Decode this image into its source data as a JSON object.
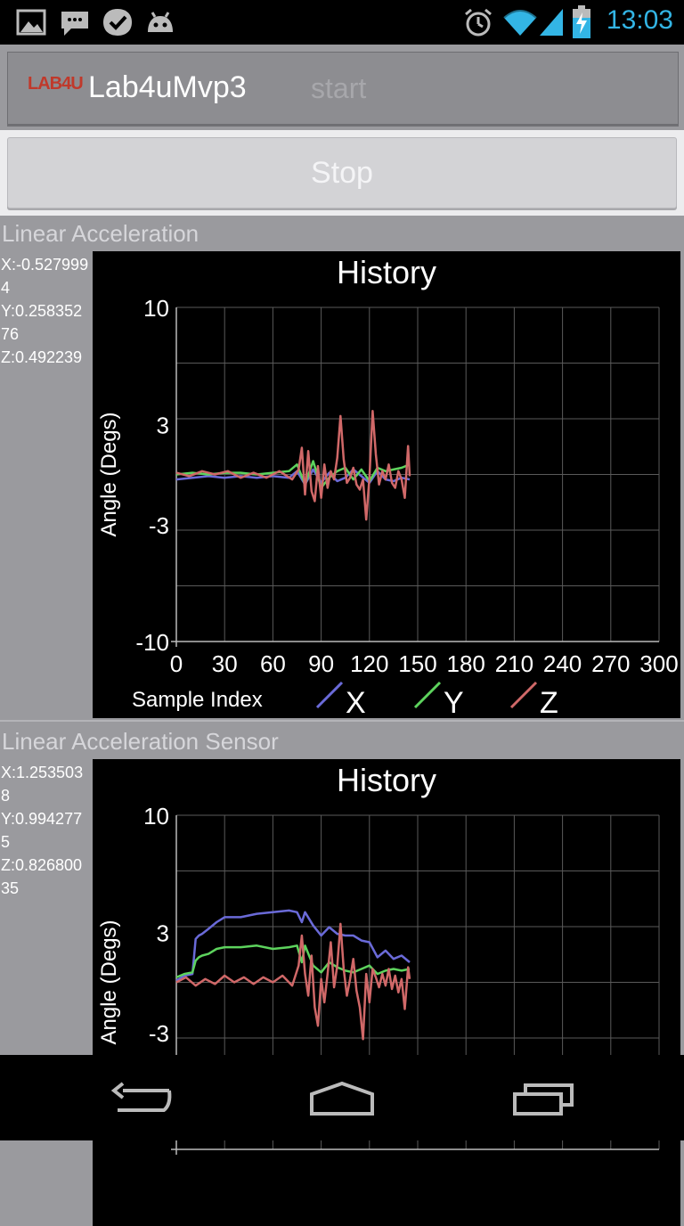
{
  "status_bar": {
    "time": "13:03",
    "icons": [
      "gallery-icon",
      "messenger-icon",
      "checkmark-app-icon",
      "android-debug-icon",
      "alarm-icon",
      "wifi-icon",
      "signal-icon",
      "battery-charging-icon"
    ],
    "accent_color": "#33b5e5"
  },
  "action_bar": {
    "logo_text": "LAB4U",
    "title": "Lab4uMvp3",
    "start_label": "start"
  },
  "stop_button": {
    "label": "Stop"
  },
  "sections": [
    {
      "label": "Linear Acceleration",
      "readout": {
        "x": "X:-0.5279994",
        "y": "Y:0.25835276",
        "z": "Z:0.492239"
      }
    },
    {
      "label": "Linear Acceleration Sensor",
      "readout": {
        "x": "X:1.2535038",
        "y": "Y:0.9942775",
        "z": "Z:0.82680035"
      }
    }
  ],
  "chart_data": [
    {
      "type": "line",
      "title": "History",
      "xlabel": "Sample Index",
      "ylabel": "Angle (Degs)",
      "xlim": [
        0,
        300
      ],
      "ylim": [
        -10,
        10
      ],
      "xticks": [
        "0",
        "30",
        "60",
        "90",
        "120",
        "150",
        "180",
        "210",
        "240",
        "270",
        "300"
      ],
      "yticks": [
        "10",
        "3",
        "-3",
        "-10"
      ],
      "grid": true,
      "legend": "bottom",
      "series": [
        {
          "name": "X",
          "color": "#6a6ad8",
          "x": [
            0,
            10,
            20,
            30,
            40,
            50,
            60,
            70,
            75,
            80,
            85,
            90,
            95,
            100,
            105,
            110,
            115,
            120,
            125,
            130,
            135,
            140,
            145
          ],
          "y": [
            -0.3,
            -0.2,
            -0.1,
            -0.2,
            -0.1,
            -0.2,
            -0.1,
            -0.2,
            0.2,
            -0.6,
            0.3,
            -0.5,
            0.1,
            -0.4,
            -0.2,
            0.3,
            -0.1,
            -0.5,
            0.2,
            -0.3,
            -0.4,
            -0.2,
            -0.3
          ]
        },
        {
          "name": "Y",
          "color": "#5dd35d",
          "x": [
            0,
            10,
            20,
            30,
            40,
            50,
            60,
            70,
            75,
            80,
            85,
            90,
            95,
            100,
            105,
            110,
            115,
            120,
            125,
            130,
            135,
            140,
            145
          ],
          "y": [
            0.0,
            0.1,
            0.0,
            0.1,
            0.1,
            0.0,
            0.1,
            0.2,
            0.6,
            -0.6,
            0.8,
            -0.8,
            -0.2,
            0.2,
            0.4,
            -0.3,
            0.3,
            -0.4,
            0.4,
            0.2,
            0.3,
            0.4,
            0.6
          ]
        },
        {
          "name": "Z",
          "color": "#d06868",
          "x": [
            0,
            8,
            16,
            24,
            32,
            40,
            48,
            56,
            64,
            72,
            76,
            78,
            80,
            82,
            84,
            86,
            88,
            90,
            92,
            94,
            96,
            98,
            100,
            102,
            104,
            106,
            108,
            110,
            112,
            114,
            116,
            118,
            120,
            122,
            124,
            126,
            128,
            130,
            132,
            134,
            136,
            138,
            140,
            142,
            144,
            145
          ],
          "y": [
            0.1,
            -0.1,
            0.2,
            0.0,
            0.2,
            -0.2,
            0.1,
            -0.2,
            0.2,
            -0.3,
            0.3,
            1.6,
            -1.2,
            1.4,
            -1.0,
            -1.6,
            0.5,
            -1.4,
            0.6,
            -0.8,
            0.2,
            -0.3,
            1.0,
            3.5,
            0.9,
            -0.5,
            -0.2,
            0.4,
            -0.6,
            -0.9,
            -0.3,
            -2.7,
            -0.2,
            3.8,
            1.2,
            -0.6,
            0.2,
            -0.3,
            0.6,
            -0.5,
            -0.8,
            0.2,
            -0.3,
            -1.4,
            1.7,
            -0.1
          ]
        }
      ]
    },
    {
      "type": "line",
      "title": "History",
      "xlabel": "",
      "ylabel": "Angle (Degs)",
      "xlim": [
        0,
        300
      ],
      "ylim": [
        -10,
        10
      ],
      "yticks": [
        "10",
        "3",
        "-3"
      ],
      "grid": true,
      "legend": "",
      "series": [
        {
          "name": "X",
          "color": "#6a6ad8",
          "x": [
            0,
            5,
            10,
            12,
            14,
            16,
            20,
            25,
            30,
            40,
            50,
            60,
            70,
            75,
            78,
            80,
            85,
            90,
            95,
            100,
            105,
            110,
            115,
            120,
            125,
            130,
            135,
            140,
            145
          ],
          "y": [
            0.1,
            0.4,
            0.5,
            2.6,
            2.8,
            2.9,
            3.2,
            3.6,
            3.9,
            3.9,
            4.1,
            4.2,
            4.3,
            4.2,
            3.6,
            4.2,
            3.4,
            2.8,
            3.3,
            2.9,
            2.8,
            2.8,
            2.5,
            2.4,
            1.5,
            1.9,
            1.4,
            1.6,
            1.2
          ]
        },
        {
          "name": "Y",
          "color": "#5dd35d",
          "x": [
            0,
            5,
            10,
            12,
            14,
            16,
            20,
            25,
            30,
            40,
            50,
            60,
            70,
            75,
            78,
            80,
            85,
            90,
            95,
            100,
            105,
            110,
            115,
            120,
            125,
            130,
            135,
            140,
            145
          ],
          "y": [
            0.3,
            0.5,
            0.6,
            1.3,
            1.5,
            1.6,
            1.7,
            2.0,
            2.1,
            2.1,
            2.2,
            2.0,
            2.1,
            2.2,
            1.2,
            2.2,
            1.0,
            0.6,
            1.2,
            0.9,
            0.7,
            0.6,
            0.8,
            1.0,
            0.5,
            0.7,
            0.8,
            0.7,
            0.8
          ]
        },
        {
          "name": "Z",
          "color": "#d06868",
          "x": [
            0,
            6,
            12,
            18,
            24,
            30,
            36,
            42,
            48,
            54,
            60,
            66,
            72,
            76,
            78,
            80,
            82,
            84,
            86,
            88,
            90,
            92,
            94,
            96,
            98,
            100,
            102,
            104,
            106,
            108,
            110,
            112,
            114,
            116,
            118,
            120,
            122,
            124,
            126,
            128,
            130,
            132,
            134,
            136,
            138,
            140,
            142,
            144,
            145
          ],
          "y": [
            0.0,
            0.3,
            -0.2,
            0.2,
            -0.1,
            0.4,
            0.0,
            0.3,
            -0.1,
            0.3,
            0.0,
            0.4,
            -0.2,
            1.0,
            2.8,
            0.5,
            -0.8,
            1.6,
            -1.5,
            -2.6,
            0.2,
            -1.2,
            0.5,
            2.4,
            -0.3,
            1.0,
            3.5,
            0.8,
            -0.8,
            0.2,
            1.4,
            -0.5,
            -1.5,
            -3.4,
            0.5,
            -1.2,
            0.8,
            0.3,
            -0.3,
            0.5,
            -0.2,
            0.8,
            -0.4,
            0.4,
            -0.6,
            0.2,
            -1.6,
            0.9,
            0.2
          ]
        }
      ]
    }
  ],
  "nav_bar": {
    "icons": [
      "back-icon",
      "home-icon",
      "recent-apps-icon"
    ]
  }
}
